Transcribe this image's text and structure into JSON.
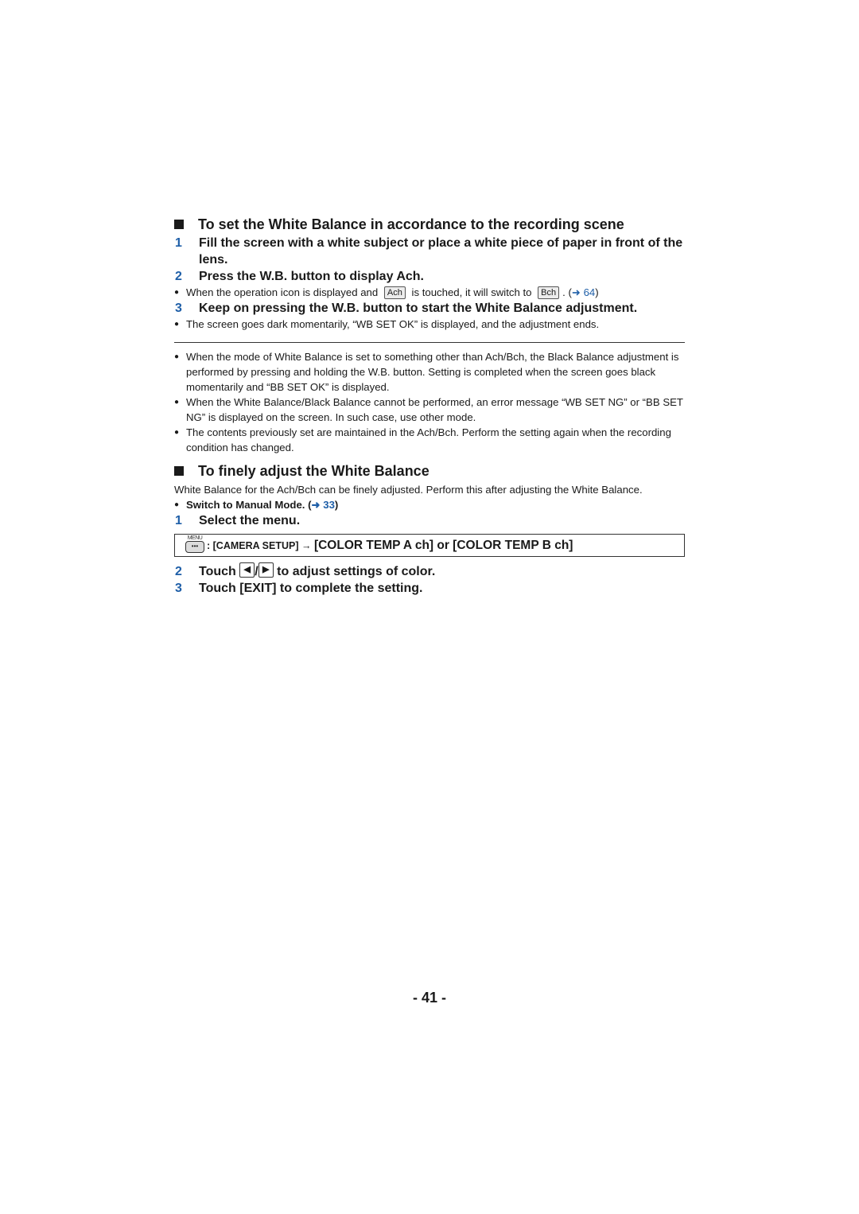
{
  "section1": {
    "heading": "To set the White Balance in accordance to the recording scene",
    "steps": [
      {
        "num": "1",
        "text": "Fill the screen with a white subject or place a white piece of paper in front of the lens."
      },
      {
        "num": "2",
        "text": "Press the W.B. button to display Ach."
      }
    ],
    "note2": {
      "part1": "When the operation icon is displayed and",
      "icon_a": "Ach",
      "part2": "is touched, it will switch to",
      "icon_b": "Bch",
      "part3": ". (",
      "ref": "➜ 64",
      "part4": ")"
    },
    "step3": {
      "num": "3",
      "text": "Keep on pressing the W.B. button to start the White Balance adjustment."
    },
    "note3": "The screen goes dark momentarily, “WB SET OK” is displayed, and the adjustment ends."
  },
  "notes": [
    "When the mode of White Balance is set to something other than Ach/Bch, the Black Balance adjustment is performed by pressing and holding the W.B. button. Setting is completed when the screen goes black momentarily and “BB SET OK” is displayed.",
    "When the White Balance/Black Balance cannot be performed, an error message “WB SET NG” or “BB SET NG” is displayed on the screen. In such case, use other mode.",
    "The contents previously set are maintained in the Ach/Bch. Perform the setting again when the recording condition has changed."
  ],
  "section2": {
    "heading": "To finely adjust the White Balance",
    "intro": "White Balance for the Ach/Bch can be finely adjusted. Perform this after adjusting the White Balance.",
    "prereq": {
      "text": "Switch to Manual Mode. (",
      "ref": "➜ 33",
      "close": ")"
    },
    "step1": {
      "num": "1",
      "text": "Select the menu."
    },
    "menu": {
      "icon_label": "MENU",
      "icon_dots": "•••",
      "path_prefix": ": [CAMERA SETUP] → ",
      "path_target": "[COLOR TEMP A ch] or [COLOR TEMP B ch]"
    },
    "step2": {
      "num": "2",
      "pre": "Touch",
      "left": "◀",
      "sep": "/",
      "right": "▶",
      "post": "to adjust settings of color."
    },
    "step3": {
      "num": "3",
      "text": "Touch [EXIT] to complete the setting."
    }
  },
  "page_number": "- 41 -"
}
